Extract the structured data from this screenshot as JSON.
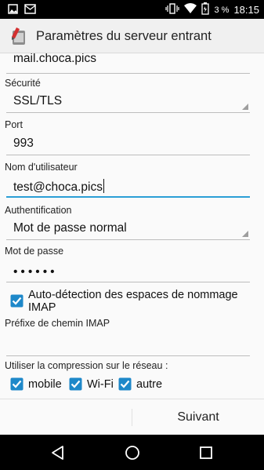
{
  "status_bar": {
    "battery_percent": "3 %",
    "time": "18:15",
    "icons": [
      "image-icon",
      "mail-icon",
      "vibrate-icon",
      "wifi-icon",
      "battery-icon"
    ]
  },
  "header": {
    "title": "Paramètres du serveur entrant",
    "icon": "app-settings-icon"
  },
  "form": {
    "server_value": "mail.choca.pics",
    "security_label": "Sécurité",
    "security_value": "SSL/TLS",
    "port_label": "Port",
    "port_value": "993",
    "username_label": "Nom d'utilisateur",
    "username_value": "test@choca.pics",
    "auth_label": "Authentification",
    "auth_value": "Mot de passe normal",
    "password_label": "Mot de passe",
    "password_value": "••••••",
    "autodetect_label": "Auto-détection des espaces de nommage IMAP",
    "autodetect_checked": true,
    "imap_prefix_label": "Préfixe de chemin IMAP",
    "imap_prefix_value": "",
    "compression_label": "Utiliser la compression sur le réseau :",
    "compression_options": [
      {
        "label": "mobile",
        "checked": true
      },
      {
        "label": "Wi-Fi",
        "checked": true
      },
      {
        "label": "autre",
        "checked": true
      }
    ]
  },
  "footer": {
    "next_label": "Suivant"
  },
  "nav": {
    "icons": [
      "back-icon",
      "home-icon",
      "recents-icon"
    ]
  },
  "colors": {
    "accent": "#2b9fd6",
    "checkbox": "#1e88c9"
  }
}
